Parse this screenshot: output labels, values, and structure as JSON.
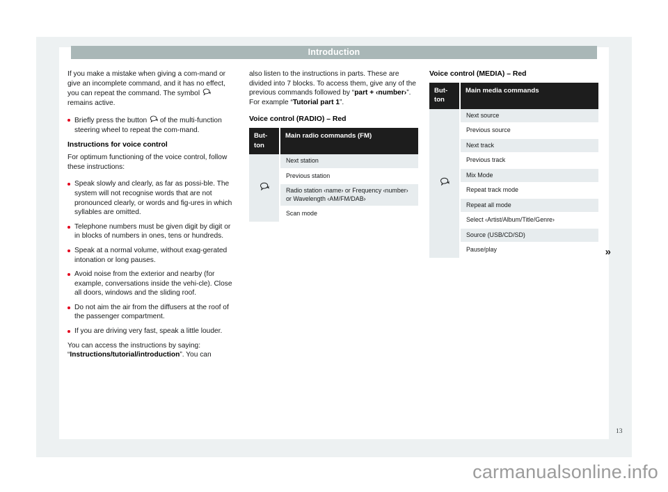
{
  "header": {
    "title": "Introduction"
  },
  "page_number": "13",
  "watermark": "carmanualsonline.info",
  "icons": {
    "voice_button": "voice-control-icon"
  },
  "column_left": {
    "para_1_a": "If you make a mistake when giving a com-mand or give an incomplete command, and it has no effect, you can repeat the command. The symbol ",
    "para_1_b": " remains active.",
    "bullet_repeat_a": "Briefly press the button ",
    "bullet_repeat_b": " of the multi-function steering wheel to repeat the com-mand.",
    "heading_instructions": "Instructions for voice control",
    "para_optimum": "For optimum functioning of the voice control, follow these instructions:",
    "bullets": [
      "Speak slowly and clearly, as far as possi-ble. The system will not recognise words that are not pronounced clearly, or words and fig-ures in which syllables are omitted.",
      "Telephone numbers must be given digit by digit or in blocks of numbers in ones, tens or hundreds.",
      "Speak at a normal volume, without exag-gerated intonation or long pauses.",
      "Avoid noise from the exterior and nearby (for example, conversations inside the vehi-cle). Close all doors, windows and the sliding roof.",
      "Do not aim the air from the diffusers at the roof of the passenger compartment.",
      "If you are driving very fast, speak a little louder."
    ],
    "para_access_a": "You can access the instructions by saying: “",
    "para_access_bold": "Instructions/tutorial/introduction",
    "para_access_b": "”. You can"
  },
  "column_middle": {
    "para_continue_a": "also listen to the instructions in parts. These are divided into 7 blocks. To access them, give any of the previous commands followed by “",
    "para_continue_bold1": "part + ‹number›",
    "para_continue_b": "”. For example “",
    "para_continue_bold2": "Tutorial part 1",
    "para_continue_c": "”.",
    "radio_table": {
      "caption": "Voice control (RADIO) – Red",
      "col_button": "But-\nton",
      "col_commands": "Main radio commands (FM)",
      "rows": [
        "Next station",
        "Previous station",
        "Radio station ‹name› or Frequency ‹number› or Wavelength ‹AM/FM/DAB›",
        "Scan mode"
      ]
    }
  },
  "column_right": {
    "media_table": {
      "caption": "Voice control (MEDIA) – Red",
      "col_button": "But-\nton",
      "col_commands": "Main media commands",
      "rows": [
        "Next source",
        "Previous source",
        "Next track",
        "Previous track",
        "Mix Mode",
        "Repeat track mode",
        "Repeat all mode",
        "Select ‹Artist/Album/Title/Genre›",
        "Source (USB/CD/SD)",
        "Pause/play"
      ],
      "continuation_arrow": "»"
    }
  },
  "colors": {
    "header_band": "#a9b7b7",
    "bullet_red": "#e3001b",
    "table_header": "#1d1d1d",
    "row_shade": "#e7ecee",
    "page_background": "#edf1f2"
  }
}
